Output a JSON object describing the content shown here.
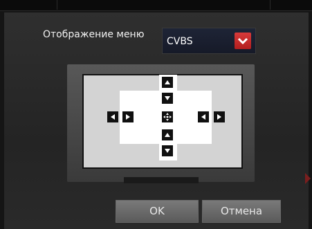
{
  "menu_display": {
    "label": "Отображение меню",
    "selected": "CVBS"
  },
  "buttons": {
    "ok_label": "OK",
    "cancel_label": "Отмена"
  },
  "icons": {
    "up": "arrow-up-icon",
    "down": "arrow-down-icon",
    "left": "arrow-left-icon",
    "right": "arrow-right-icon",
    "move": "move-icon",
    "dropdown": "chevron-down-icon"
  },
  "colors": {
    "accent_red": "#c62828",
    "background": "#2a2a2a"
  }
}
